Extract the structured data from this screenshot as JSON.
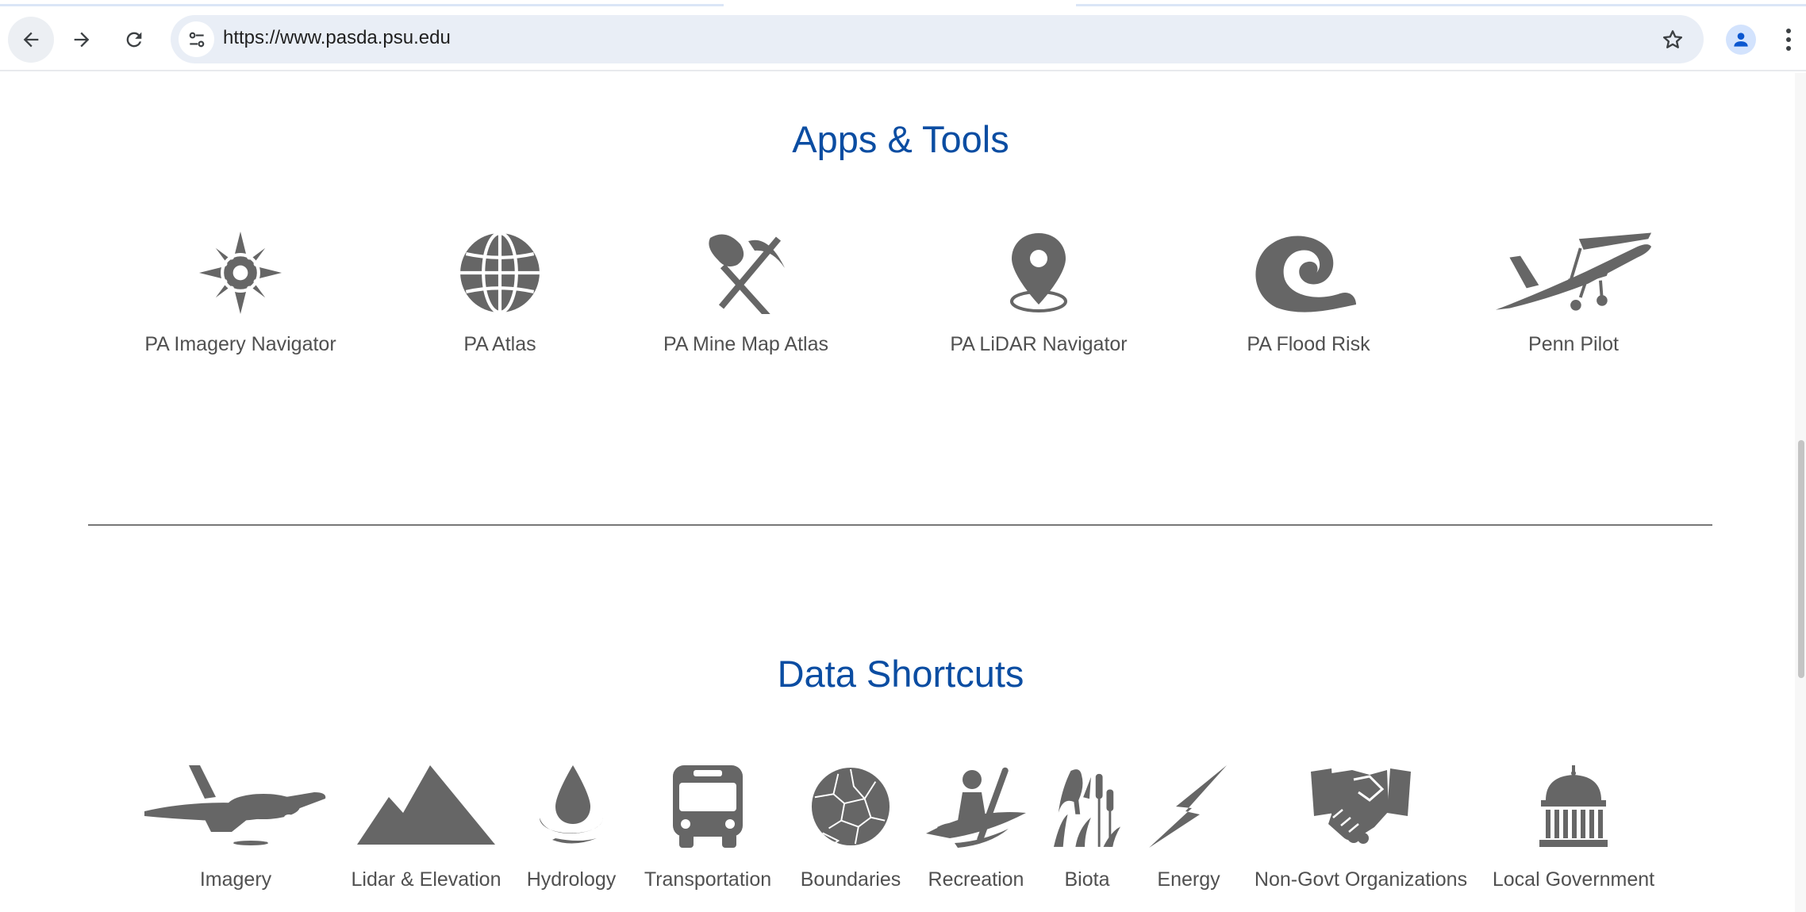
{
  "browser": {
    "url": "https://www.pasda.psu.edu"
  },
  "icons": {
    "back": "arrow-left-icon",
    "forward": "arrow-right-icon",
    "reload": "reload-icon",
    "site_info": "tune-icon",
    "bookmark": "star-outline-icon",
    "profile": "person-icon",
    "menu": "more-vert-icon"
  },
  "colors": {
    "heading": "#0b4da2",
    "icon": "#666666",
    "label": "#505050"
  },
  "apps_tools": {
    "title": "Apps & Tools",
    "items": [
      {
        "label": "PA Imagery Navigator",
        "icon": "compass-icon"
      },
      {
        "label": "PA Atlas",
        "icon": "globe-icon"
      },
      {
        "label": "PA Mine Map Atlas",
        "icon": "shovel-pickaxe-icon"
      },
      {
        "label": "PA LiDAR Navigator",
        "icon": "map-pin-icon"
      },
      {
        "label": "PA Flood Risk",
        "icon": "wave-icon"
      },
      {
        "label": "Penn Pilot",
        "icon": "airplane-icon"
      }
    ]
  },
  "data_shortcuts": {
    "title": "Data Shortcuts",
    "items": [
      {
        "label": "Imagery",
        "icon": "small-plane-icon"
      },
      {
        "label": "Lidar & Elevation",
        "icon": "mountains-icon"
      },
      {
        "label": "Hydrology",
        "icon": "water-drop-icon"
      },
      {
        "label": "Transportation",
        "icon": "bus-icon"
      },
      {
        "label": "Boundaries",
        "icon": "boundaries-map-icon"
      },
      {
        "label": "Recreation",
        "icon": "kayak-icon"
      },
      {
        "label": "Biota",
        "icon": "bird-cattail-icon"
      },
      {
        "label": "Energy",
        "icon": "lightning-icon"
      },
      {
        "label": "Non-Govt Organizations",
        "icon": "handshake-icon"
      },
      {
        "label": "Local Government",
        "icon": "capitol-building-icon"
      }
    ]
  }
}
